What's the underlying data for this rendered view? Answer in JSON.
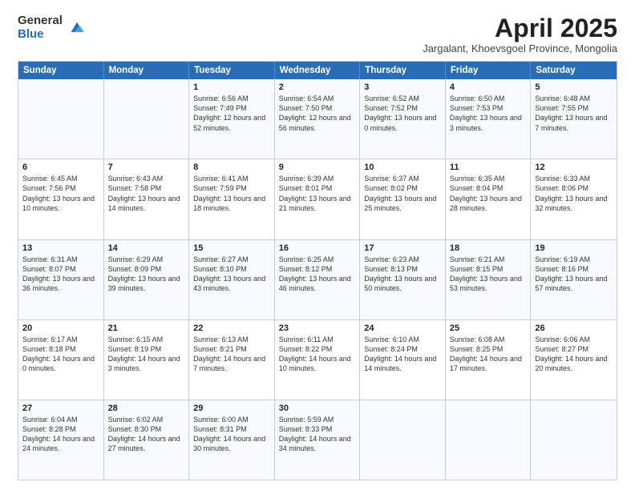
{
  "logo": {
    "general": "General",
    "blue": "Blue"
  },
  "title": "April 2025",
  "subtitle": "Jargalant, Khoevsgoel Province, Mongolia",
  "headers": [
    "Sunday",
    "Monday",
    "Tuesday",
    "Wednesday",
    "Thursday",
    "Friday",
    "Saturday"
  ],
  "weeks": [
    [
      {
        "day": "",
        "info": ""
      },
      {
        "day": "",
        "info": ""
      },
      {
        "day": "1",
        "info": "Sunrise: 6:56 AM\nSunset: 7:49 PM\nDaylight: 12 hours and 52 minutes."
      },
      {
        "day": "2",
        "info": "Sunrise: 6:54 AM\nSunset: 7:50 PM\nDaylight: 12 hours and 56 minutes."
      },
      {
        "day": "3",
        "info": "Sunrise: 6:52 AM\nSunset: 7:52 PM\nDaylight: 13 hours and 0 minutes."
      },
      {
        "day": "4",
        "info": "Sunrise: 6:50 AM\nSunset: 7:53 PM\nDaylight: 13 hours and 3 minutes."
      },
      {
        "day": "5",
        "info": "Sunrise: 6:48 AM\nSunset: 7:55 PM\nDaylight: 13 hours and 7 minutes."
      }
    ],
    [
      {
        "day": "6",
        "info": "Sunrise: 6:45 AM\nSunset: 7:56 PM\nDaylight: 13 hours and 10 minutes."
      },
      {
        "day": "7",
        "info": "Sunrise: 6:43 AM\nSunset: 7:58 PM\nDaylight: 13 hours and 14 minutes."
      },
      {
        "day": "8",
        "info": "Sunrise: 6:41 AM\nSunset: 7:59 PM\nDaylight: 13 hours and 18 minutes."
      },
      {
        "day": "9",
        "info": "Sunrise: 6:39 AM\nSunset: 8:01 PM\nDaylight: 13 hours and 21 minutes."
      },
      {
        "day": "10",
        "info": "Sunrise: 6:37 AM\nSunset: 8:02 PM\nDaylight: 13 hours and 25 minutes."
      },
      {
        "day": "11",
        "info": "Sunrise: 6:35 AM\nSunset: 8:04 PM\nDaylight: 13 hours and 28 minutes."
      },
      {
        "day": "12",
        "info": "Sunrise: 6:33 AM\nSunset: 8:06 PM\nDaylight: 13 hours and 32 minutes."
      }
    ],
    [
      {
        "day": "13",
        "info": "Sunrise: 6:31 AM\nSunset: 8:07 PM\nDaylight: 13 hours and 36 minutes."
      },
      {
        "day": "14",
        "info": "Sunrise: 6:29 AM\nSunset: 8:09 PM\nDaylight: 13 hours and 39 minutes."
      },
      {
        "day": "15",
        "info": "Sunrise: 6:27 AM\nSunset: 8:10 PM\nDaylight: 13 hours and 43 minutes."
      },
      {
        "day": "16",
        "info": "Sunrise: 6:25 AM\nSunset: 8:12 PM\nDaylight: 13 hours and 46 minutes."
      },
      {
        "day": "17",
        "info": "Sunrise: 6:23 AM\nSunset: 8:13 PM\nDaylight: 13 hours and 50 minutes."
      },
      {
        "day": "18",
        "info": "Sunrise: 6:21 AM\nSunset: 8:15 PM\nDaylight: 13 hours and 53 minutes."
      },
      {
        "day": "19",
        "info": "Sunrise: 6:19 AM\nSunset: 8:16 PM\nDaylight: 13 hours and 57 minutes."
      }
    ],
    [
      {
        "day": "20",
        "info": "Sunrise: 6:17 AM\nSunset: 8:18 PM\nDaylight: 14 hours and 0 minutes."
      },
      {
        "day": "21",
        "info": "Sunrise: 6:15 AM\nSunset: 8:19 PM\nDaylight: 14 hours and 3 minutes."
      },
      {
        "day": "22",
        "info": "Sunrise: 6:13 AM\nSunset: 8:21 PM\nDaylight: 14 hours and 7 minutes."
      },
      {
        "day": "23",
        "info": "Sunrise: 6:11 AM\nSunset: 8:22 PM\nDaylight: 14 hours and 10 minutes."
      },
      {
        "day": "24",
        "info": "Sunrise: 6:10 AM\nSunset: 8:24 PM\nDaylight: 14 hours and 14 minutes."
      },
      {
        "day": "25",
        "info": "Sunrise: 6:08 AM\nSunset: 8:25 PM\nDaylight: 14 hours and 17 minutes."
      },
      {
        "day": "26",
        "info": "Sunrise: 6:06 AM\nSunset: 8:27 PM\nDaylight: 14 hours and 20 minutes."
      }
    ],
    [
      {
        "day": "27",
        "info": "Sunrise: 6:04 AM\nSunset: 8:28 PM\nDaylight: 14 hours and 24 minutes."
      },
      {
        "day": "28",
        "info": "Sunrise: 6:02 AM\nSunset: 8:30 PM\nDaylight: 14 hours and 27 minutes."
      },
      {
        "day": "29",
        "info": "Sunrise: 6:00 AM\nSunset: 8:31 PM\nDaylight: 14 hours and 30 minutes."
      },
      {
        "day": "30",
        "info": "Sunrise: 5:59 AM\nSunset: 8:33 PM\nDaylight: 14 hours and 34 minutes."
      },
      {
        "day": "",
        "info": ""
      },
      {
        "day": "",
        "info": ""
      },
      {
        "day": "",
        "info": ""
      }
    ]
  ]
}
